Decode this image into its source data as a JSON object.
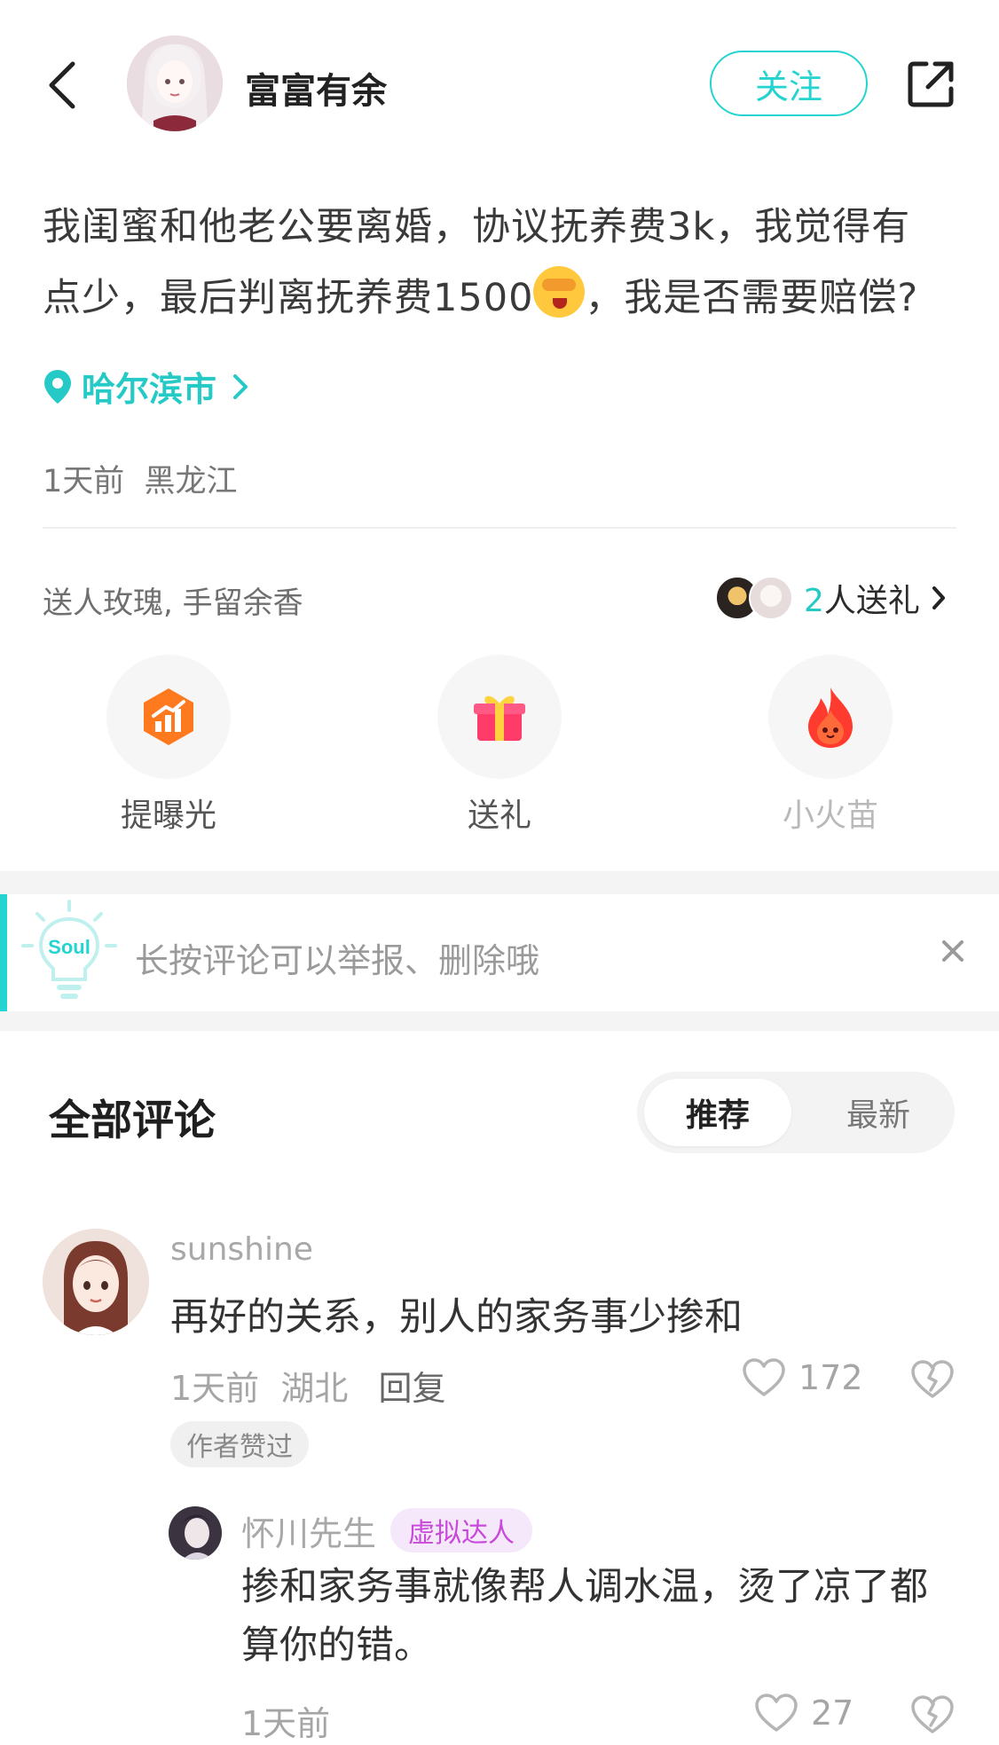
{
  "header": {
    "username": "富富有余",
    "follow_label": "关注"
  },
  "post": {
    "text_before_emoji": "我闺蜜和他老公要离婚，协议抚养费3k，我觉得有点少，最后判离抚养费1500",
    "text_after_emoji": "，我是否需要赔偿?",
    "emoji_icon": "see-no-evil-face-icon",
    "location": "哈尔滨市",
    "time": "1天前",
    "region": "黑龙江"
  },
  "gifts": {
    "caption": "送人玫瑰, 手留余香",
    "count": "2",
    "count_suffix": "人送礼",
    "actions": [
      {
        "label": "提曝光",
        "icon": "boost-exposure-icon"
      },
      {
        "label": "送礼",
        "icon": "gift-box-icon"
      },
      {
        "label": "小火苗",
        "icon": "flame-icon"
      }
    ]
  },
  "tip": {
    "logo_text": "Soul",
    "text": "长按评论可以举报、删除哦"
  },
  "comments": {
    "title": "全部评论",
    "sort_tabs": [
      "推荐",
      "最新"
    ],
    "active_tab": "推荐",
    "items": [
      {
        "user": "sunshine",
        "text": "再好的关系，别人的家务事少掺和",
        "time": "1天前",
        "region": "湖北",
        "reply_label": "回复",
        "likes": "172",
        "badge": "作者赞过",
        "replies": [
          {
            "user": "怀川先生",
            "tag": "虚拟达人",
            "text": "掺和家务事就像帮人调水温，烫了凉了都算你的错。",
            "time": "1天前",
            "likes": "27"
          }
        ]
      }
    ]
  },
  "colors": {
    "accent": "#25d4d0",
    "tag_purple": "#c84ad9"
  }
}
